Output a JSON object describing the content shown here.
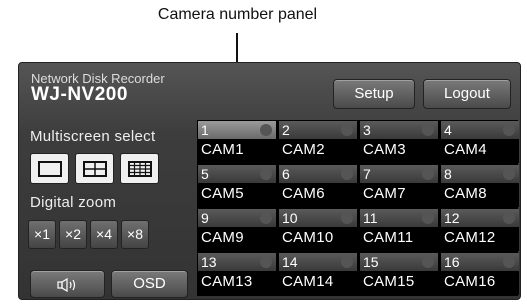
{
  "callout": {
    "label": "Camera number panel"
  },
  "brand": {
    "line1": "Network Disk Recorder",
    "line2": "WJ-NV200"
  },
  "header": {
    "setup_label": "Setup",
    "logout_label": "Logout"
  },
  "multiscreen": {
    "label": "Multiscreen select",
    "options": [
      "single-screen-icon",
      "quad-screen-icon",
      "sixteen-screen-icon"
    ]
  },
  "zoom": {
    "label": "Digital zoom",
    "options": [
      "×1",
      "×2",
      "×4",
      "×8"
    ]
  },
  "bottom": {
    "sound_label": "▫ ",
    "osd_label": "OSD"
  },
  "cameras": [
    {
      "num": "1",
      "name": "CAM1"
    },
    {
      "num": "2",
      "name": "CAM2"
    },
    {
      "num": "3",
      "name": "CAM3"
    },
    {
      "num": "4",
      "name": "CAM4"
    },
    {
      "num": "5",
      "name": "CAM5"
    },
    {
      "num": "6",
      "name": "CAM6"
    },
    {
      "num": "7",
      "name": "CAM7"
    },
    {
      "num": "8",
      "name": "CAM8"
    },
    {
      "num": "9",
      "name": "CAM9"
    },
    {
      "num": "10",
      "name": "CAM10"
    },
    {
      "num": "11",
      "name": "CAM11"
    },
    {
      "num": "12",
      "name": "CAM12"
    },
    {
      "num": "13",
      "name": "CAM13"
    },
    {
      "num": "14",
      "name": "CAM14"
    },
    {
      "num": "15",
      "name": "CAM15"
    },
    {
      "num": "16",
      "name": "CAM16"
    }
  ],
  "colors": {
    "panel_bg": "#3d3d3d",
    "indicator": "#555555"
  }
}
